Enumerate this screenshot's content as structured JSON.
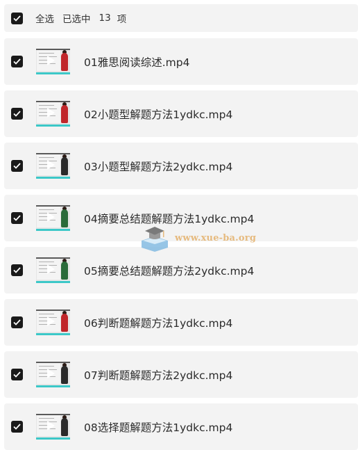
{
  "header": {
    "select_all_label": "全选",
    "selected_prefix": "已选中",
    "selected_count": "13",
    "selected_unit": "项",
    "checked": true
  },
  "files": [
    {
      "name": "01雅思阅读综述.mp4",
      "checked": true,
      "outfit_color": "#c0262a"
    },
    {
      "name": "02小题型解题方法1ydkc.mp4",
      "checked": true,
      "outfit_color": "#c0262a"
    },
    {
      "name": "03小题型解题方法2ydkc.mp4",
      "checked": true,
      "outfit_color": "#2a2a2a"
    },
    {
      "name": "04摘要总结题解题方法1ydkc.mp4",
      "checked": true,
      "outfit_color": "#2a6b3a"
    },
    {
      "name": "05摘要总结题解题方法2ydkc.mp4",
      "checked": true,
      "outfit_color": "#2a6b3a"
    },
    {
      "name": "06判断题解题方法1ydkc.mp4",
      "checked": true,
      "outfit_color": "#c0262a"
    },
    {
      "name": "07判断题解题方法2ydkc.mp4",
      "checked": true,
      "outfit_color": "#2a2a2a"
    },
    {
      "name": "08选择题解题方法1ydkc.mp4",
      "checked": true,
      "outfit_color": "#2a2a2a"
    }
  ],
  "watermark": {
    "text": "www.xue-ba.org",
    "icon": "graduation-cap-book-icon",
    "color": "#e6ba7e"
  },
  "colors": {
    "row_background": "#f3f3f3",
    "checkbox": "#1a1a1a",
    "progress_bar": "#3cc8c8"
  }
}
